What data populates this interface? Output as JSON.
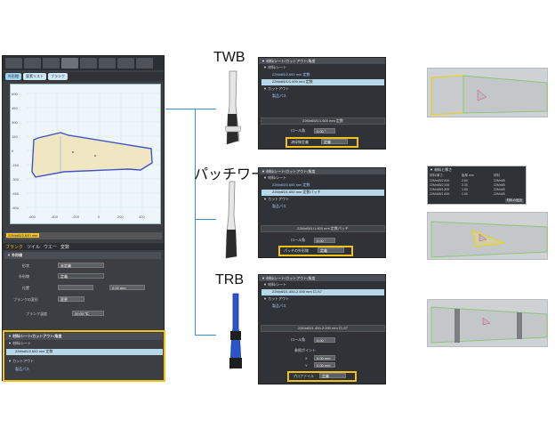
{
  "left_panel": {
    "tabs": [
      "外形線",
      "要素リスト",
      "ブランク"
    ],
    "plot": {
      "y_ticks": [
        "600",
        "450",
        "300",
        "150",
        "0",
        "-150",
        "-300",
        "-450",
        "-600"
      ],
      "x_ticks": [
        "-600",
        "-400",
        "-200",
        "0",
        "200",
        "400",
        "600"
      ]
    },
    "size_label": "22Mn65/2.600 mm",
    "prop_tabs": [
      "ブランク",
      "ツイル",
      "ウエー",
      "変数"
    ],
    "section_outline": "▼ 外形線",
    "rows": {
      "r1_label": "形状",
      "r1_val": "未定義",
      "r2_label": "外形線",
      "r2_val": "定義",
      "r3_label": "位置",
      "r3_val": "0.00 mm",
      "r4_label": "ブランクの変形",
      "r4_val": "変更",
      "r5_label": "ブランク温度",
      "r5_val": "20.00 ℃"
    },
    "materials_header": "▼ 材料/シート/カットアウト/角度",
    "materials_sub": "▼ 材料/シート",
    "material_item": "22Mn65/2.600 mm 定数",
    "cutout_label": "▼ カットアウト",
    "cutout_item": "製品パス"
  },
  "labels": {
    "twb": "TWB",
    "patchwork": "パッチワーク",
    "trb": "TRB"
  },
  "panels": [
    {
      "head": "▼ 材料/シート/カットアウト/角度",
      "sub": "▼ 材料/シート",
      "items": [
        "22Mn65/2.600 mm 定数",
        "22Mn65/1/1.600 mm 定数"
      ],
      "cutout": "▼ カットアウト",
      "cutout_item": "製品パス",
      "bar": "22Mn65/1/1.600 mm 定数",
      "row_label": "ロール角",
      "row_val": "0.00 °",
      "button_label": "溶接線定義",
      "button_val": "定義"
    },
    {
      "head": "▼ 材料/シート/カットアウト/角度",
      "sub": "▼ 材料/シート",
      "items": [
        "22Mn65/2.600 mm 定数",
        "22Mn65/1.600 mm 定数パッチ"
      ],
      "cutout": "▼ カットアウト",
      "cutout_item": "製品パス",
      "bar": "22Mn65/1/1.600 mm 定数パッチ",
      "row_label": "ロール角",
      "row_val": "0.00 °",
      "button_label": "パッチの外形線",
      "button_val": "定義"
    },
    {
      "head": "▼ 材料/シート/カットアウト/角度",
      "sub": "▼ 材料/シート",
      "items": [
        "22Mn65/1.400-2.000 mm ロ-S7"
      ],
      "cutout": "▼ カットアウト",
      "cutout_item": "製品パス",
      "bar": "22Mn65/1.400-2.000 mm ロ-S7",
      "row_label": "ロール角",
      "row_val": "0.00 °",
      "extra_label": "参照ポイント",
      "x_label": "X",
      "x_val": "0.00 mm",
      "y_label": "Y",
      "y_val": "0.00 mm",
      "button_label": "プロファイル",
      "button_val": "定義"
    }
  ],
  "side_table": {
    "title": "▼ 材料と厚さ",
    "rows": [
      [
        "材料/厚さ",
        "板厚 mm",
        "材料"
      ],
      [
        "22Mn65/2.600",
        "2.60",
        "22Mn65"
      ],
      [
        "22Mn65/2.000",
        "2.00",
        "22Mn65"
      ],
      [
        "22Mn65/1.800",
        "1.80",
        "22Mn65"
      ],
      [
        "22Mn65/1.600",
        "1.60",
        "22Mn65"
      ]
    ],
    "footer": "材料の追加"
  },
  "colors": {
    "accent": "#f2c11b",
    "arrow": "#3a8fd0",
    "sheet": "#efe7c2",
    "outline": "#4254c8"
  }
}
